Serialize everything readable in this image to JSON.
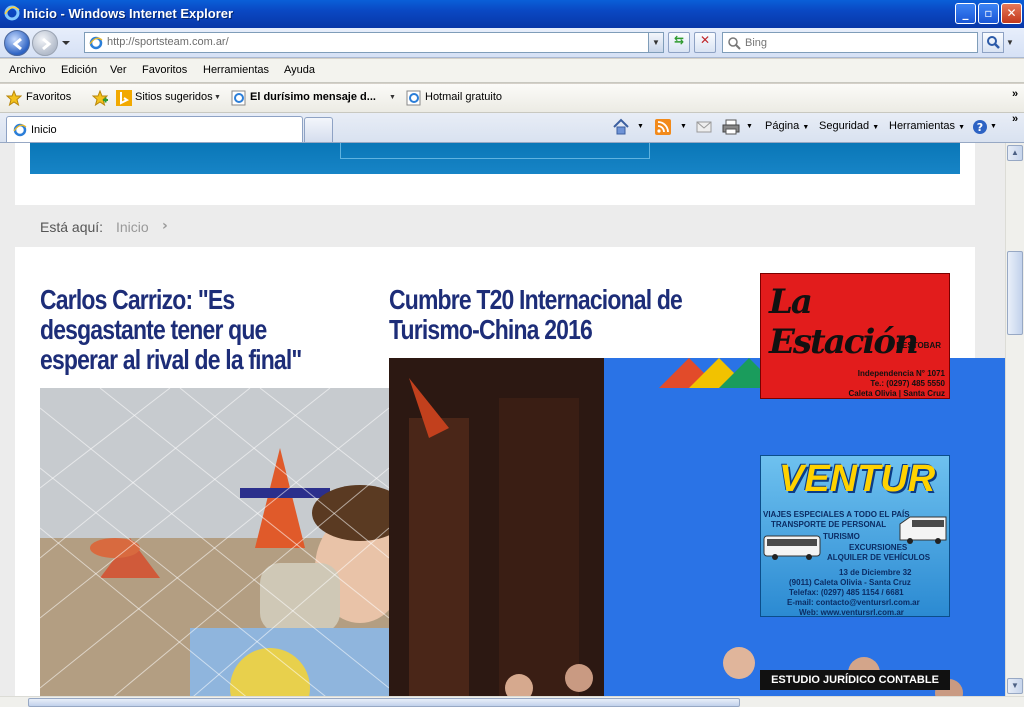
{
  "window": {
    "title": "Inicio - Windows Internet Explorer",
    "controls": {
      "minimize": "_",
      "maximize": "▫",
      "close": "✕"
    }
  },
  "address_bar": {
    "url": "http://sportsteam.com.ar/",
    "search_placeholder": "Bing"
  },
  "menu": [
    "Archivo",
    "Edición",
    "Ver",
    "Favoritos",
    "Herramientas",
    "Ayuda"
  ],
  "favorites_bar": {
    "favorites_label": "Favoritos",
    "items": [
      "Sitios sugeridos",
      "El durísimo mensaje d...",
      "Hotmail gratuito"
    ],
    "overflow": "»"
  },
  "tabs": [
    {
      "label": "Inicio"
    }
  ],
  "command_bar": {
    "page": "Página",
    "security": "Seguridad",
    "tools": "Herramientas"
  },
  "page": {
    "breadcrumb": {
      "label": "Está aquí:",
      "home": "Inicio",
      "separator": "›"
    },
    "articles": [
      {
        "headline": "Carlos Carrizo: \"Es desgastante tener que esperar al rival de la final\""
      },
      {
        "headline": "Cumbre T20 Internacional de Turismo-China 2016"
      }
    ],
    "ads": {
      "estacion": {
        "brand": "La Estación",
        "sub": "RESTOBAR",
        "address": "Independencia N° 1071",
        "phone": "Te.: (0297) 485 5550",
        "city": "Caleta Olivia | Santa Cruz"
      },
      "ventur": {
        "brand": "VENTUR",
        "lines": [
          "VIAJES ESPECIALES A TODO EL PAÍS",
          "TRANSPORTE DE PERSONAL",
          "TURISMO",
          "EXCURSIONES",
          "ALQUILER DE VEHÍCULOS",
          "13 de Diciembre 32",
          "(9011) Caleta Olivia - Santa Cruz",
          "Telefax: (0297) 485 1154 / 6681",
          "E-mail: contacto@ventursrl.com.ar",
          "Web: www.ventursrl.com.ar"
        ]
      },
      "estudio": {
        "label": "ESTUDIO JURÍDICO CONTABLE"
      }
    }
  }
}
